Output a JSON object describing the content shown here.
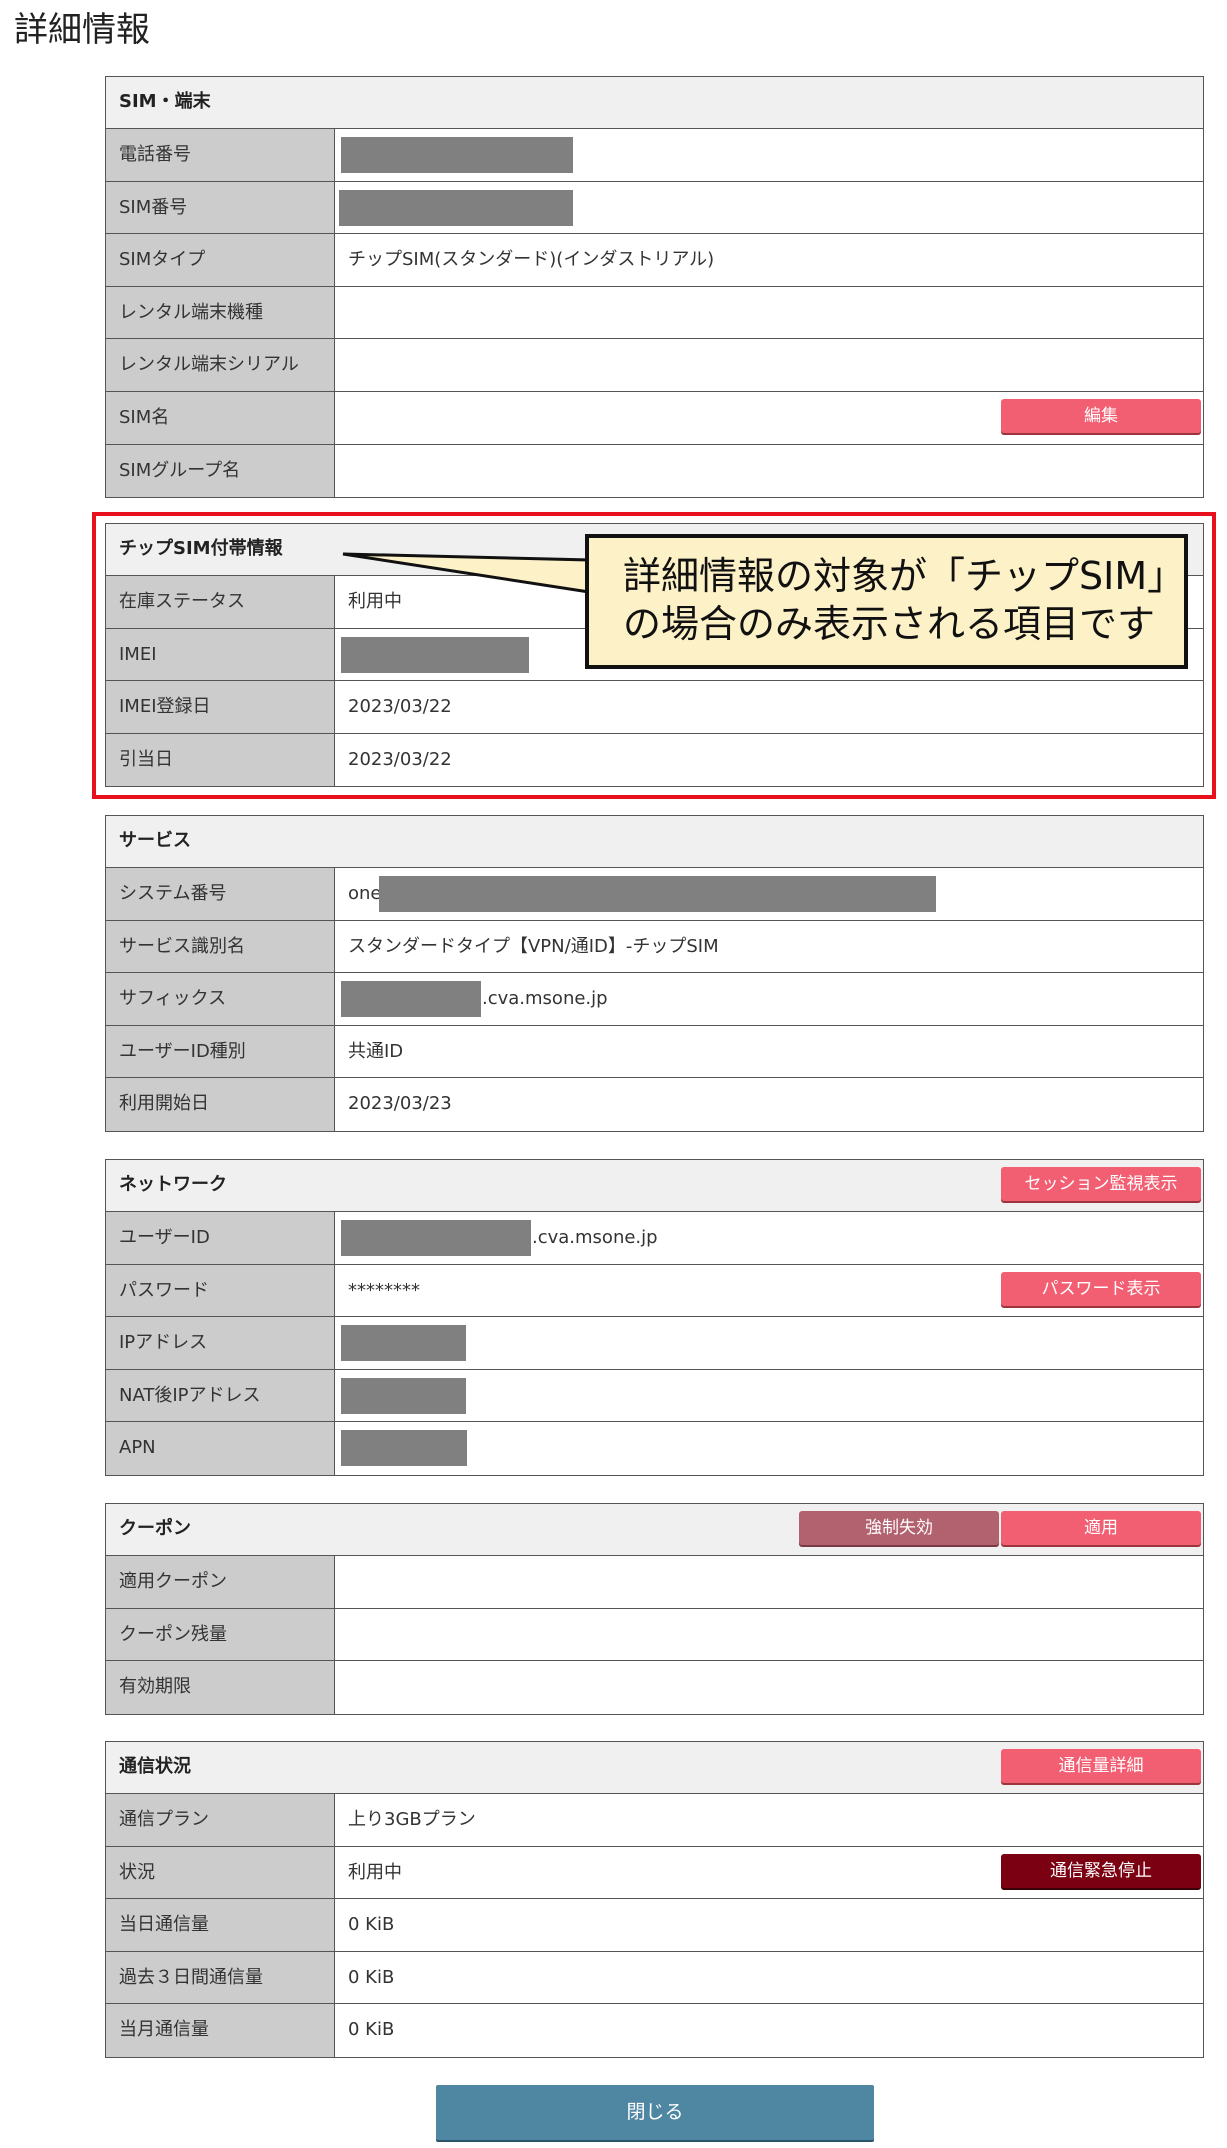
{
  "page_title": "詳細情報",
  "sections": {
    "sim": {
      "title": "SIM・端末",
      "rows": [
        {
          "label": "電話番号",
          "value": ""
        },
        {
          "label": "SIM番号",
          "value": ""
        },
        {
          "label": "SIMタイプ",
          "value": "チップSIM(スタンダード)(インダストリアル)"
        },
        {
          "label": "レンタル端末機種",
          "value": ""
        },
        {
          "label": "レンタル端末シリアル",
          "value": ""
        },
        {
          "label": "SIM名",
          "value": ""
        },
        {
          "label": "SIMグループ名",
          "value": ""
        }
      ],
      "edit_button": "編集"
    },
    "chip": {
      "title": "チップSIM付帯情報",
      "rows": [
        {
          "label": "在庫ステータス",
          "value": "利用中"
        },
        {
          "label": "IMEI",
          "value": ""
        },
        {
          "label": "IMEI登録日",
          "value": "2023/03/22"
        },
        {
          "label": "引当日",
          "value": "2023/03/22"
        }
      ]
    },
    "service": {
      "title": "サービス",
      "rows": [
        {
          "label": "システム番号",
          "value": "one"
        },
        {
          "label": "サービス識別名",
          "value": "スタンダードタイプ【VPN/通ID】-チップSIM"
        },
        {
          "label": "サフィックス",
          "value": ".cva.msone.jp"
        },
        {
          "label": "ユーザーID種別",
          "value": "共通ID"
        },
        {
          "label": "利用開始日",
          "value": "2023/03/23"
        }
      ]
    },
    "network": {
      "title": "ネットワーク",
      "session_button": "セッション監視表示",
      "rows": [
        {
          "label": "ユーザーID",
          "value": ".cva.msone.jp"
        },
        {
          "label": "パスワード",
          "value": "********"
        },
        {
          "label": "IPアドレス",
          "value": ""
        },
        {
          "label": "NAT後IPアドレス",
          "value": ""
        },
        {
          "label": "APN",
          "value": ""
        }
      ],
      "password_button": "パスワード表示"
    },
    "coupon": {
      "title": "クーポン",
      "revoke_button": "強制失効",
      "apply_button": "適用",
      "rows": [
        {
          "label": "適用クーポン",
          "value": ""
        },
        {
          "label": "クーポン残量",
          "value": ""
        },
        {
          "label": "有効期限",
          "value": ""
        }
      ]
    },
    "traffic": {
      "title": "通信状況",
      "detail_button": "通信量詳細",
      "rows": [
        {
          "label": "通信プラン",
          "value": "上り3GBプラン"
        },
        {
          "label": "状況",
          "value": "利用中"
        },
        {
          "label": "当日通信量",
          "value": "0 KiB"
        },
        {
          "label": "過去３日間通信量",
          "value": "0 KiB"
        },
        {
          "label": "当月通信量",
          "value": "0 KiB"
        }
      ],
      "emergency_button": "通信緊急停止"
    }
  },
  "callout": {
    "line1": "詳細情報の対象が「チップSIM」",
    "line2": "の場合のみ表示される項目です"
  },
  "close_button": "閉じる",
  "colors": {
    "pink_button": "#f35f72",
    "mauve_button": "#b2626e",
    "dark_red_button": "#7a0012",
    "close_button": "#4f87a2",
    "highlight_border": "#e8101c",
    "callout_bg": "#fdf1c8",
    "redaction": "#808080"
  }
}
